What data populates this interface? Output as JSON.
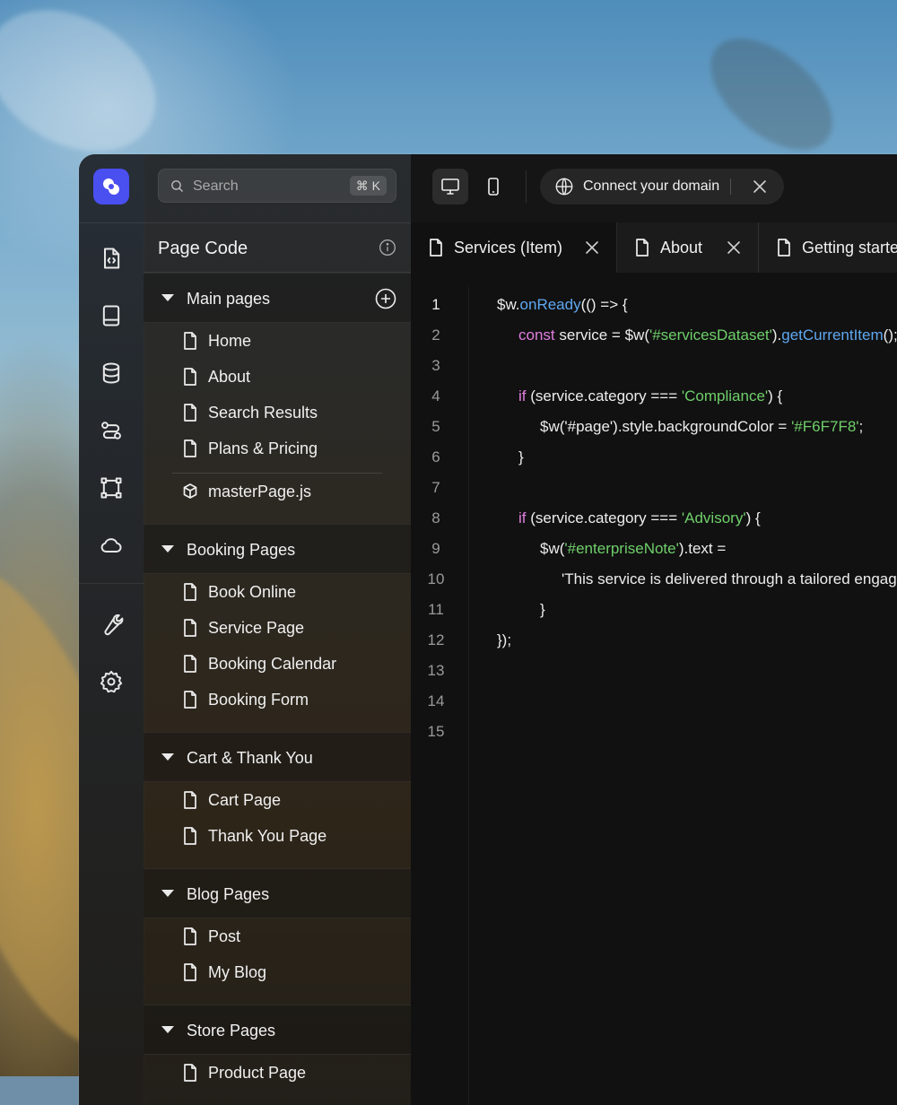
{
  "search": {
    "placeholder": "Search",
    "shortcut": "⌘ K"
  },
  "panel": {
    "title": "Page Code",
    "sections": [
      {
        "label": "Main pages",
        "items": [
          "Home",
          "About",
          "Search Results",
          "Plans & Pricing"
        ],
        "extra": "masterPage.js"
      },
      {
        "label": "Booking Pages",
        "items": [
          "Book Online",
          "Service Page",
          "Booking Calendar",
          "Booking Form"
        ]
      },
      {
        "label": "Cart & Thank You",
        "items": [
          "Cart Page",
          "Thank You Page"
        ]
      },
      {
        "label": "Blog Pages",
        "items": [
          "Post",
          "My Blog"
        ]
      },
      {
        "label": "Store Pages",
        "items": [
          "Product Page"
        ]
      }
    ]
  },
  "rail": {
    "icons": [
      "code-file-icon",
      "book-icon",
      "database-icon",
      "flow-icon",
      "frame-icon",
      "cloud-icon",
      "wrench-icon",
      "gear-icon"
    ]
  },
  "topbar": {
    "domain_label": "Connect your domain"
  },
  "tabs": [
    {
      "label": "Services (Item)"
    },
    {
      "label": "About"
    },
    {
      "label": "Getting started"
    }
  ],
  "editor": {
    "line_numbers": [
      "1",
      "2",
      "3",
      "4",
      "5",
      "6",
      "7",
      "8",
      "9",
      "10",
      "11",
      "12",
      "13",
      "14",
      "15"
    ],
    "lines": [
      [
        {
          "t": "$w.",
          "c": ""
        },
        {
          "t": "onReady",
          "c": "fn"
        },
        {
          "t": "(() => {",
          "c": ""
        }
      ],
      [
        {
          "t": "const",
          "c": "kw"
        },
        {
          "t": " service = $w(",
          "c": ""
        },
        {
          "t": "'#servicesDataset'",
          "c": "str"
        },
        {
          "t": ").",
          "c": ""
        },
        {
          "t": "getCurrentItem",
          "c": "fn"
        },
        {
          "t": "();",
          "c": ""
        }
      ],
      [],
      [
        {
          "t": "if",
          "c": "kw"
        },
        {
          "t": " (service.category === ",
          "c": ""
        },
        {
          "t": "'Compliance'",
          "c": "str"
        },
        {
          "t": ") {",
          "c": ""
        }
      ],
      [
        {
          "t": "$w('#page').style.backgroundColor = ",
          "c": ""
        },
        {
          "t": "'#F6F7F8'",
          "c": "str"
        },
        {
          "t": ";",
          "c": ""
        }
      ],
      [
        {
          "t": "}",
          "c": ""
        }
      ],
      [],
      [
        {
          "t": "if",
          "c": "kw"
        },
        {
          "t": " (service.category === ",
          "c": ""
        },
        {
          "t": "'Advisory'",
          "c": "str"
        },
        {
          "t": ") {",
          "c": ""
        }
      ],
      [
        {
          "t": "$w(",
          "c": ""
        },
        {
          "t": "'#enterpriseNote'",
          "c": "str"
        },
        {
          "t": ").text =",
          "c": ""
        }
      ],
      [
        {
          "t": "'This service is delivered through a tailored engagement model.';",
          "c": ""
        }
      ],
      [
        {
          "t": "}",
          "c": ""
        }
      ],
      [
        {
          "t": "});",
          "c": ""
        }
      ],
      [],
      [],
      []
    ]
  }
}
